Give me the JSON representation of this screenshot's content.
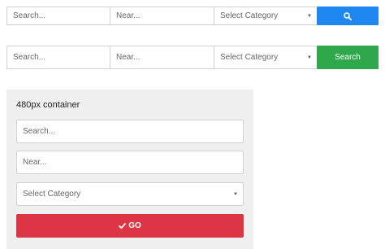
{
  "row1": {
    "search_placeholder": "Search...",
    "near_placeholder": "Near...",
    "category_selected": "Select Category",
    "button_icon": "search-icon",
    "button_color": "#1e87f0"
  },
  "row2": {
    "search_placeholder": "Search...",
    "near_placeholder": "Near...",
    "category_selected": "Select Category",
    "button_label": "Search",
    "button_color": "#2ea84a"
  },
  "container": {
    "title": "480px container",
    "search_placeholder": "Search...",
    "near_placeholder": "Near...",
    "category_selected": "Select Category",
    "button_label": "GO",
    "button_icon": "check-icon",
    "button_color": "#dc3545"
  }
}
